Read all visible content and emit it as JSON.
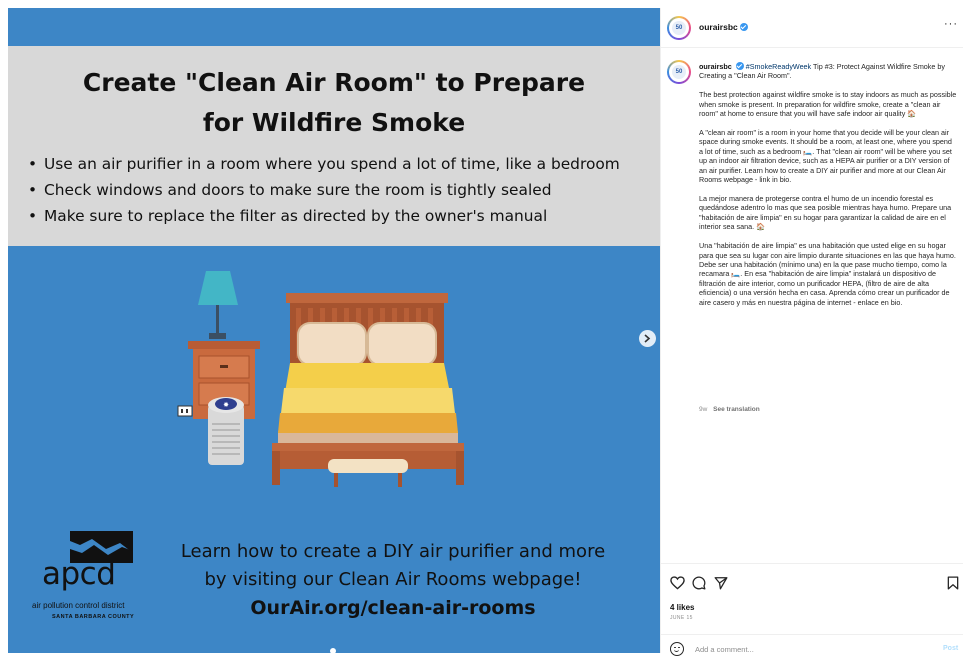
{
  "post_image": {
    "headline_line1": "Create \"Clean Air Room\" to Prepare",
    "headline_line2": "for Wildfire Smoke",
    "bullets": [
      "Use an air purifier in a room where you spend a lot of time, like a bedroom",
      "Check windows and doors to make sure the room is tightly sealed",
      "Make sure to replace the filter as directed by the owner's manual"
    ],
    "logo_text": "apcd",
    "logo_sub1": "air pollution control district",
    "logo_sub2": "SANTA BARBARA COUNTY",
    "cta_line1": "Learn how to create a DIY air purifier and more",
    "cta_line2": "by visiting our Clean Air Rooms webpage!",
    "cta_url": "OurAir.org/clean-air-rooms",
    "purifier_display": "✸"
  },
  "sidebar": {
    "avatar_label": "50",
    "username": "ourairsbc",
    "more_label": "···",
    "caption": {
      "username": "ourairsbc",
      "hashtag": "#SmokeReadyWeek",
      "intro": " Tip #3: Protect Against Wildfire Smoke by Creating a \"Clean Air Room\".",
      "p1": "The best protection against wildfire smoke is to stay indoors as much as possible when smoke is present. In preparation for wildfire smoke, create a \"clean air room\" at home to ensure that you will have safe indoor air quality 🏠",
      "p2": "A \"clean air room\" is a room in your home that you decide will be your clean air space during smoke events. It should be a room, at least one, where you spend a lot of time, such as a bedroom 🛏️. That \"clean air room\" will be where you set up an indoor air filtration device, such as a HEPA air purifier or a DIY version of an air purifier. Learn how to create a DIY air purifier and more at our Clean Air Rooms webpage - link in bio.",
      "p3": "La mejor manera de protegerse contra el humo de un incendio forestal es quedándose adentro lo mas que sea posible mientras haya humo. Prepare una \"habitación de aire limpia\" en su hogar para garantizar la calidad de aire en el interior sea sana. 🏠",
      "p4": "Una \"habitación de aire limpia\" es una habitación que usted elige en su hogar para que sea su lugar con aire limpio durante situaciones en las que haya humo. Debe ser una habitación (mínimo una) en la que pase mucho tiempo, como la recamara 🛏️. En esa \"habitación de aire limpia\" instalará un dispositivo de filtración de aire interior, como un purificador HEPA, (filtro de aire de alta eficiencia) o una versión hecha en casa. Aprenda cómo crear un purificador de aire casero y más en nuestra página de internet - enlace en bio."
    },
    "age": "9w",
    "see_translation": "See translation",
    "likes": "4 likes",
    "date": "JUNE 15",
    "comment_placeholder": "Add a comment...",
    "post_label": "Post"
  },
  "colors": {
    "image_blue": "#3d86c6",
    "panel_gray": "#d8d8d8",
    "link_blue": "#00376b",
    "verified_blue": "#3897f0",
    "post_disabled": "#b2dffc"
  }
}
